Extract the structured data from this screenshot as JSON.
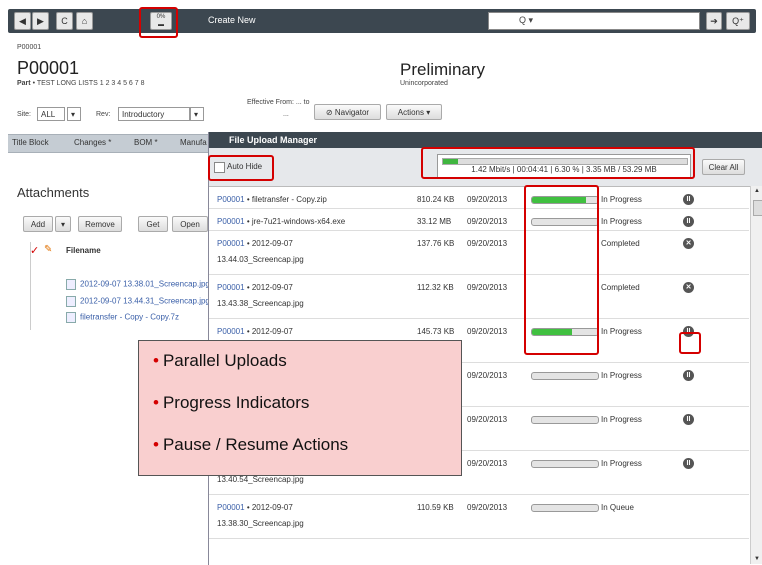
{
  "toolbar": {
    "back": "◀",
    "forward": "▶",
    "refresh": "C",
    "home": "⌂",
    "upload_pct": "0%",
    "create_new": "Create New",
    "search_placeholder": "Q ▾",
    "go": "➔",
    "adv_search": "Q⁺"
  },
  "header": {
    "small_id": "P00001",
    "part_number": "P00001",
    "part_label": "Part",
    "part_desc": "TEST LONG LISTS 1 2 3 4 5 6 7 8",
    "status": "Preliminary",
    "sub_status": "Unincorporated",
    "site_label": "Site:",
    "site_value": "ALL",
    "rev_label": "Rev:",
    "rev_value": "Introductory",
    "effective_label": "Effective From:",
    "effective_value": "... to",
    "effective_end": "...",
    "navigator": "Navigator",
    "actions": "Actions ▾"
  },
  "tabs": [
    "Title Block",
    "Changes *",
    "BOM *",
    "Manufa"
  ],
  "left": {
    "attachments_title": "Attachments",
    "add": "Add",
    "remove": "Remove",
    "get": "Get",
    "open": "Open",
    "filename_header": "Filename",
    "files": [
      "2012-09-07 13.38.01_Screencap.jpg",
      "2012-09-07 13.44.31_Screencap.jpg",
      "filetransfer - Copy - Copy.7z"
    ]
  },
  "fum": {
    "title": "File Upload Manager",
    "auto_hide": "Auto Hide",
    "overall_text": "1.42 Mbit/s | 00:04:41 | 6.30 % | 3.35 MB / 53.29 MB",
    "overall_progress": 0.063,
    "clear_all": "Clear All",
    "rows": [
      {
        "id": "P00001",
        "name": "filetransfer - Copy.zip",
        "name2": "",
        "size": "810.24 KB",
        "date": "09/20/2013",
        "progress": 0.82,
        "status": "In Progress",
        "action": "pause"
      },
      {
        "id": "P00001",
        "name": "jre-7u21-windows-x64.exe",
        "name2": "",
        "size": "33.12 MB",
        "date": "09/20/2013",
        "progress": 0.0,
        "status": "In Progress",
        "action": "pause"
      },
      {
        "id": "P00001",
        "name": "2012-09-07",
        "name2": "13.44.03_Screencap.jpg",
        "size": "137.76 KB",
        "date": "09/20/2013",
        "progress": null,
        "status": "Completed",
        "action": "remove"
      },
      {
        "id": "P00001",
        "name": "2012-09-07",
        "name2": "13.43.38_Screencap.jpg",
        "size": "112.32 KB",
        "date": "09/20/2013",
        "progress": null,
        "status": "Completed",
        "action": "remove"
      },
      {
        "id": "P00001",
        "name": "2012-09-07",
        "name2": "",
        "size": "145.73 KB",
        "date": "09/20/2013",
        "progress": 0.6,
        "status": "In Progress",
        "action": "pause"
      },
      {
        "id": "",
        "name": "",
        "name2": "",
        "size": "",
        "date": "09/20/2013",
        "progress": 0.0,
        "status": "In Progress",
        "action": "pause"
      },
      {
        "id": "",
        "name": "",
        "name2": "",
        "size": "",
        "date": "09/20/2013",
        "progress": 0.0,
        "status": "In Progress",
        "action": "pause"
      },
      {
        "id": "",
        "name": "",
        "name2": "13.40.54_Screencap.jpg",
        "size": "",
        "date": "09/20/2013",
        "progress": 0.0,
        "status": "In Progress",
        "action": "pause"
      },
      {
        "id": "P00001",
        "name": "2012-09-07",
        "name2": "13.38.30_Screencap.jpg",
        "size": "110.59 KB",
        "date": "09/20/2013",
        "progress": 0.0,
        "status": "In Queue",
        "action": "none"
      }
    ]
  },
  "callout": [
    "Parallel Uploads",
    "Progress Indicators",
    "Pause / Resume Actions"
  ],
  "colors": {
    "toolbar": "#3c4750",
    "progress": "#40c040",
    "highlight": "#d40000",
    "callout_bg": "#f9cfcf"
  }
}
